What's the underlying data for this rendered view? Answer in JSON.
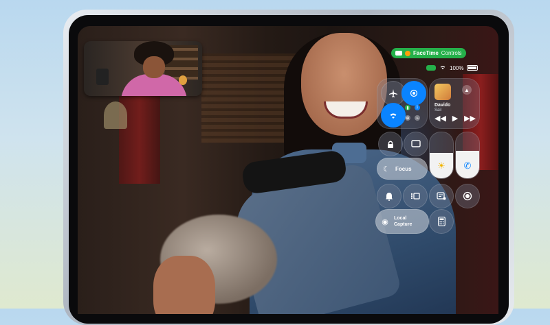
{
  "facetime_pill": {
    "app": "FaceTime",
    "action": "Controls",
    "color": "#25b04a"
  },
  "status_bar": {
    "battery": "100%",
    "wifi_icon": "wifi-icon"
  },
  "control_center": {
    "connectivity": {
      "airplane_icon": "airplane-icon",
      "airdrop_icon": "airdrop-icon",
      "wifi_icon": "wifi-icon",
      "cellular_icon": "cellular-icon",
      "bluetooth_icon": "bluetooth-icon",
      "vpn_icon": "vpn-icon",
      "hotspot_icon": "hotspot-icon"
    },
    "now_playing": {
      "title": "Davido",
      "subtitle": "Sail",
      "prev_icon": "backward-icon",
      "play_icon": "play-icon",
      "next_icon": "forward-icon"
    },
    "orientation_lock_icon": "lock-rotation-icon",
    "screen_mirror_icon": "screen-mirror-icon",
    "focus": {
      "label": "Focus"
    },
    "brightness": {
      "level": 0.55,
      "icon": "sun-icon"
    },
    "volume": {
      "level": 0.6,
      "icon": "phone-icon"
    },
    "bell_icon": "bell-icon",
    "stage_manager_icon": "stage-manager-icon",
    "notes_icon": "quick-note-icon",
    "record_icon": "screen-record-icon",
    "local_capture": {
      "line1": "Local",
      "line2": "Capture"
    },
    "calculator_icon": "calculator-icon",
    "accent": "#0a84ff"
  }
}
